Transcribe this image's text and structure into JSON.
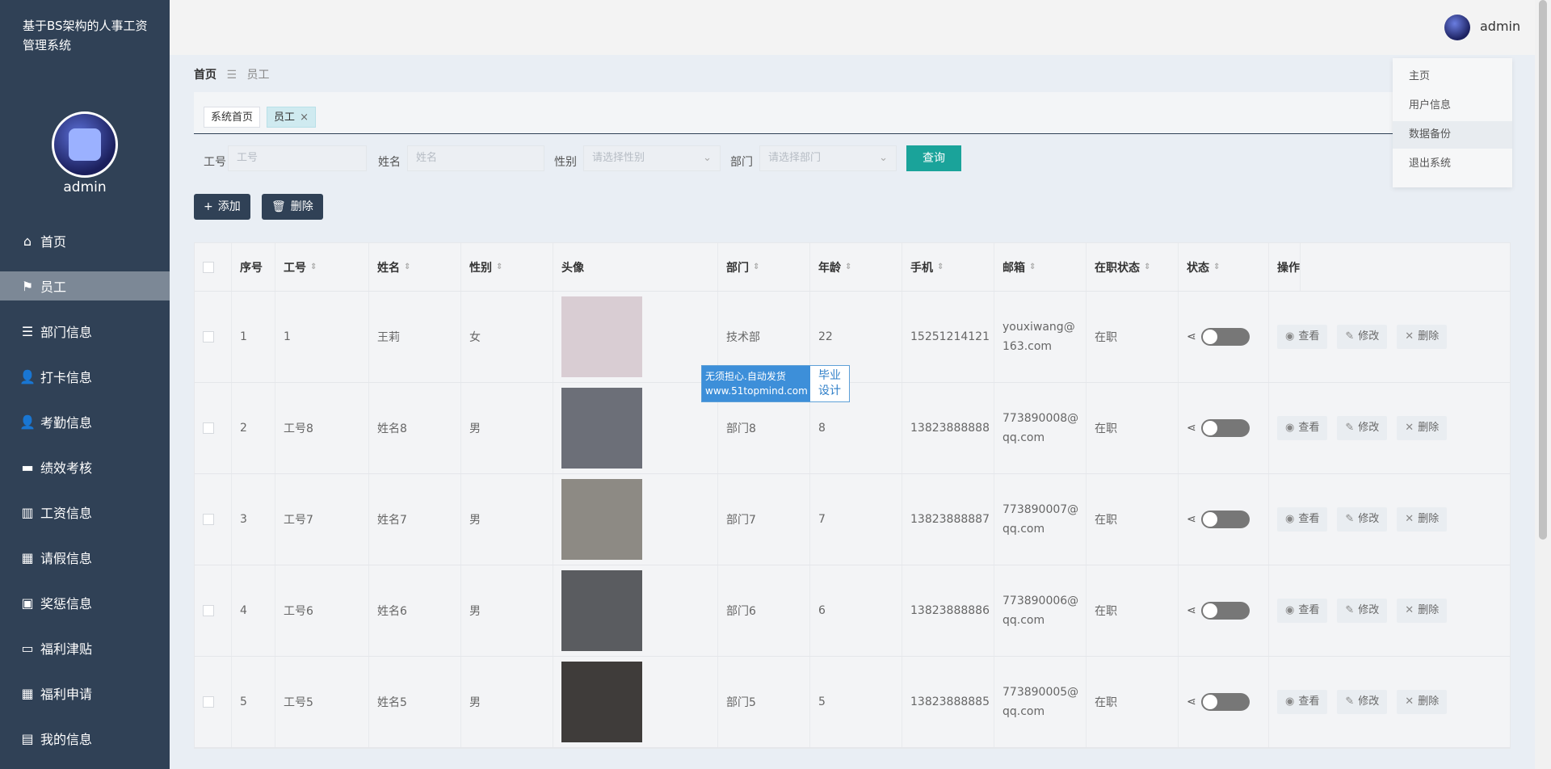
{
  "app": {
    "title": "基于BS架构的人事工资管理系统"
  },
  "sidebar": {
    "username": "admin",
    "items": [
      {
        "label": "首页",
        "icon": "home-icon",
        "active": false
      },
      {
        "label": "员工",
        "icon": "flag-icon",
        "active": true
      },
      {
        "label": "部门信息",
        "icon": "sliders-icon",
        "active": false
      },
      {
        "label": "打卡信息",
        "icon": "user-icon",
        "active": false
      },
      {
        "label": "考勤信息",
        "icon": "user-solid-icon",
        "active": false
      },
      {
        "label": "绩效考核",
        "icon": "monitor-icon",
        "active": false
      },
      {
        "label": "工资信息",
        "icon": "book-icon",
        "active": false
      },
      {
        "label": "请假信息",
        "icon": "grid-icon",
        "active": false
      },
      {
        "label": "奖惩信息",
        "icon": "gift-icon",
        "active": false
      },
      {
        "label": "福利津贴",
        "icon": "display-icon",
        "active": false
      },
      {
        "label": "福利申请",
        "icon": "grid-icon",
        "active": false
      },
      {
        "label": "我的信息",
        "icon": "card-icon",
        "active": false
      }
    ]
  },
  "header": {
    "username": "admin"
  },
  "breadcrumb": {
    "home": "首页",
    "current": "员工"
  },
  "tags": [
    {
      "label": "系统首页"
    },
    {
      "label": "员工"
    }
  ],
  "search": {
    "fields": [
      {
        "label": "工号",
        "placeholder": "工号"
      },
      {
        "label": "姓名",
        "placeholder": "姓名"
      },
      {
        "label": "性别",
        "placeholder": "请选择性别"
      },
      {
        "label": "部门",
        "placeholder": "请选择部门"
      }
    ],
    "query_label": "查询"
  },
  "actions": {
    "add_label": "添加",
    "delete_label": "删除"
  },
  "table": {
    "columns": [
      "序号",
      "工号",
      "姓名",
      "性别",
      "头像",
      "部门",
      "年龄",
      "手机",
      "邮箱",
      "在职状态",
      "状态",
      "操作"
    ],
    "rows": [
      {
        "no": "1",
        "id": "1",
        "name": "王莉",
        "gender": "女",
        "dept": "技术部",
        "age": "22",
        "phone": "15251214121",
        "email1": "youxiwang@",
        "email2": "163.com",
        "status": "在职",
        "photo": "#d9cdd3"
      },
      {
        "no": "2",
        "id": "工号8",
        "name": "姓名8",
        "gender": "男",
        "dept": "部门8",
        "age": "8",
        "phone": "13823888888",
        "email1": "773890008@",
        "email2": "qq.com",
        "status": "在职",
        "photo": "#6c6f78"
      },
      {
        "no": "3",
        "id": "工号7",
        "name": "姓名7",
        "gender": "男",
        "dept": "部门7",
        "age": "7",
        "phone": "13823888887",
        "email1": "773890007@",
        "email2": "qq.com",
        "status": "在职",
        "photo": "#8d8a84"
      },
      {
        "no": "4",
        "id": "工号6",
        "name": "姓名6",
        "gender": "男",
        "dept": "部门6",
        "age": "6",
        "phone": "13823888886",
        "email1": "773890006@",
        "email2": "qq.com",
        "status": "在职",
        "photo": "#5a5c60"
      },
      {
        "no": "5",
        "id": "工号5",
        "name": "姓名5",
        "gender": "男",
        "dept": "部门5",
        "age": "5",
        "phone": "13823888885",
        "email1": "773890005@",
        "email2": "qq.com",
        "status": "在职",
        "photo": "#3f3c3a"
      }
    ],
    "row_actions": {
      "view": "查看",
      "edit": "修改",
      "delete": "删除"
    }
  },
  "dropdown": {
    "items": [
      "主页",
      "用户信息",
      "数据备份",
      "退出系统"
    ]
  },
  "watermark": {
    "line1": "无须担心.自动发货",
    "line2": "www.51topmind.com",
    "right1": "毕业",
    "right2": "设计"
  }
}
